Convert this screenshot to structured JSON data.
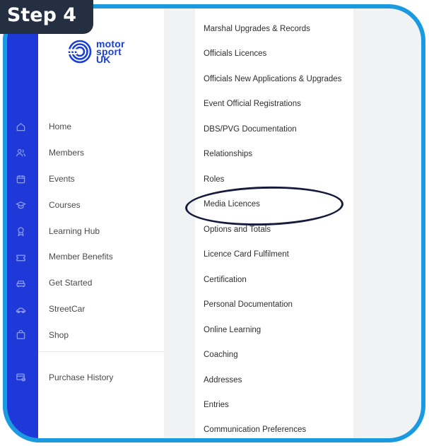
{
  "badge": {
    "label": "Step 4"
  },
  "logo": {
    "line1": "motor",
    "line2": "sport",
    "line3": "UK"
  },
  "sidebar": {
    "items": [
      {
        "label": "Home",
        "icon": "home-icon"
      },
      {
        "label": "Members",
        "icon": "members-icon"
      },
      {
        "label": "Events",
        "icon": "calendar-icon"
      },
      {
        "label": "Courses",
        "icon": "graduation-cap-icon"
      },
      {
        "label": "Learning Hub",
        "icon": "award-icon"
      },
      {
        "label": "Member Benefits",
        "icon": "ticket-icon"
      },
      {
        "label": "Get Started",
        "icon": "car-icon"
      },
      {
        "label": "StreetCar",
        "icon": "sports-car-icon"
      },
      {
        "label": "Shop",
        "icon": "shopping-bag-icon"
      }
    ],
    "footer_item": {
      "label": "Purchase History",
      "icon": "receipt-icon"
    }
  },
  "menu": {
    "items": [
      "Marshal Upgrades & Records",
      "Officials Licences",
      "Officials New Applications & Upgrades",
      "Event Official Registrations",
      "DBS/PVG Documentation",
      "Relationships",
      "Roles",
      "Media Licences",
      "Options and Totals",
      "Licence Card Fulfilment",
      "Certification",
      "Personal Documentation",
      "Online Learning",
      "Coaching",
      "Addresses",
      "Entries",
      "Communication Preferences"
    ],
    "highlighted": "Media Licences"
  },
  "colors": {
    "rail": "#1f38d8",
    "frame": "#1a9ae0",
    "badge": "#243042",
    "ring": "#171b3b"
  }
}
